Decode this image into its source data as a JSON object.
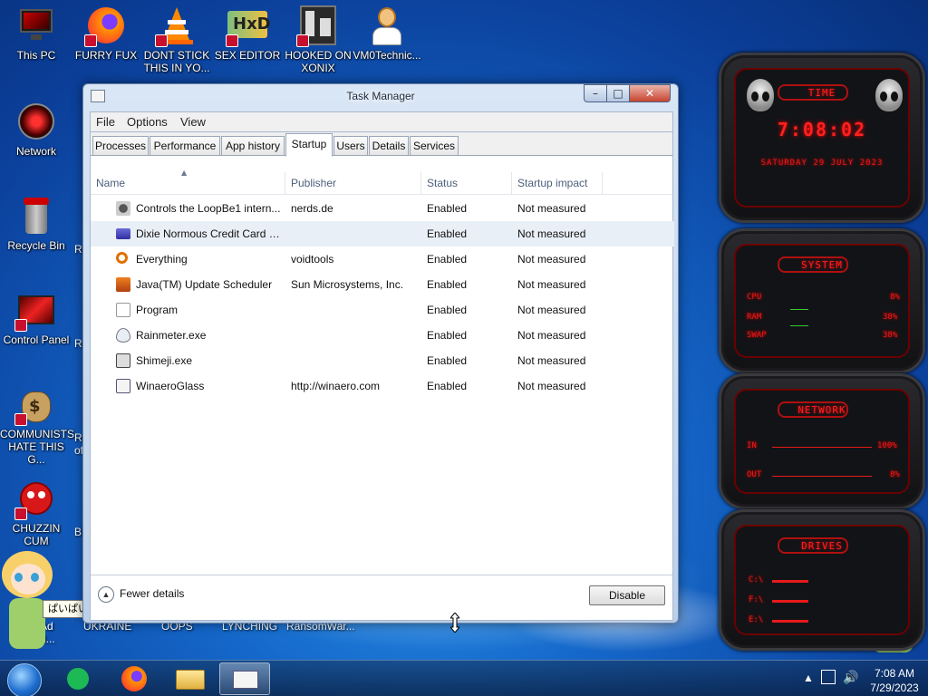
{
  "desktop": {
    "icons": [
      {
        "label": "This PC",
        "icon": "monitor-icon"
      },
      {
        "label": "FURRY FUX",
        "icon": "firefox-icon"
      },
      {
        "label": "DONT STICK\nTHIS IN YO...",
        "icon": "vlc-cone-icon"
      },
      {
        "label": "SEX EDITOR",
        "icon": "hxd-editor-icon"
      },
      {
        "label": "HOOKED ON\nXONIX",
        "icon": "xonix-game-icon"
      },
      {
        "label": "VM0Technic...",
        "icon": "doctor-icon"
      },
      {
        "label": "Network",
        "icon": "network-icon"
      },
      {
        "label": "Recycle Bin",
        "icon": "recycle-bin-icon"
      },
      {
        "label": "Control Panel",
        "icon": "control-panel-icon"
      },
      {
        "label": "COMMUNISTS\nHATE THIS G...",
        "icon": "money-bag-icon"
      },
      {
        "label": "CHUZZIN\nCUM",
        "icon": "chuzzle-icon"
      }
    ],
    "partial_labels": [
      "Re",
      "Re",
      "Re",
      "Re",
      "of",
      "B",
      "Ad",
      "Al...",
      "UKRAINE",
      "OOPS",
      "LYNCHING",
      "RansomWar..."
    ],
    "tooltip": "ぱいぱいい"
  },
  "window": {
    "title": "Task Manager",
    "menu": [
      "File",
      "Options",
      "View"
    ],
    "tabs": [
      "Processes",
      "Performance",
      "App history",
      "Startup",
      "Users",
      "Details",
      "Services"
    ],
    "active_tab": "Startup",
    "columns": [
      "Name",
      "Publisher",
      "Status",
      "Startup impact"
    ],
    "rows": [
      {
        "name": "Controls the LoopBe1 intern...",
        "publisher": "nerds.de",
        "status": "Enabled",
        "impact": "Not measured",
        "icon": "loopbe-icon"
      },
      {
        "name": "Dixie Normous Credit Card S...",
        "publisher": "",
        "status": "Enabled",
        "impact": "Not measured",
        "icon": "credit-card-icon"
      },
      {
        "name": "Everything",
        "publisher": "voidtools",
        "status": "Enabled",
        "impact": "Not measured",
        "icon": "magnifier-icon"
      },
      {
        "name": "Java(TM) Update Scheduler",
        "publisher": "Sun Microsystems, Inc.",
        "status": "Enabled",
        "impact": "Not measured",
        "icon": "java-icon"
      },
      {
        "name": "Program",
        "publisher": "",
        "status": "Enabled",
        "impact": "Not measured",
        "icon": "blank-file-icon"
      },
      {
        "name": "Rainmeter.exe",
        "publisher": "",
        "status": "Enabled",
        "impact": "Not measured",
        "icon": "raindrop-icon"
      },
      {
        "name": "Shimeji.exe",
        "publisher": "",
        "status": "Enabled",
        "impact": "Not measured",
        "icon": "shimeji-icon"
      },
      {
        "name": "WinaeroGlass",
        "publisher": "http://winaero.com",
        "status": "Enabled",
        "impact": "Not measured",
        "icon": "window-icon"
      }
    ],
    "fewer_details": "Fewer details",
    "disable_button": "Disable"
  },
  "widgets": {
    "time": {
      "title": "TIME",
      "clock": "7:08:02",
      "date": "SATURDAY 29 JULY 2023"
    },
    "system": {
      "title": "SYSTEM",
      "cpu_label": "CPU",
      "cpu_value": "8%",
      "ram_label": "RAM",
      "ram_value": "38%",
      "swap_label": "SWAP",
      "swap_value": "38%"
    },
    "network": {
      "title": "NETWORK",
      "in_label": "IN",
      "in_value": "100%",
      "out_label": "OUT",
      "out_value": "8%"
    },
    "drives": {
      "title": "DRIVES",
      "drives": [
        "C:\\",
        "F:\\",
        "E:\\"
      ]
    }
  },
  "taskbar": {
    "time": "7:08 AM",
    "date": "7/29/2023"
  },
  "colors": {
    "accent_red": "#e81a1a",
    "selection": "#e9eff6"
  }
}
